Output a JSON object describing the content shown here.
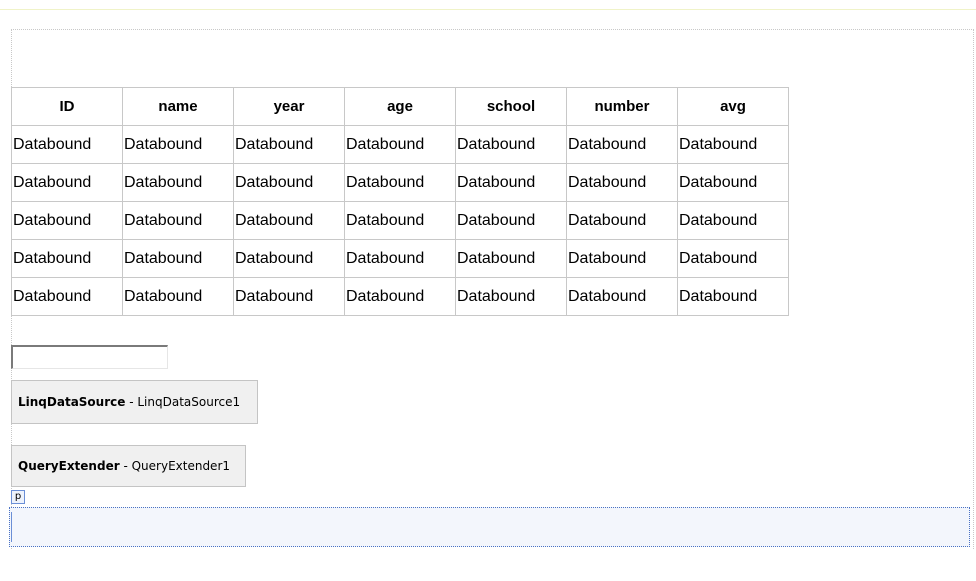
{
  "grid": {
    "headers": [
      "ID",
      "name",
      "year",
      "age",
      "school",
      "number",
      "avg"
    ],
    "rows": [
      [
        "Databound",
        "Databound",
        "Databound",
        "Databound",
        "Databound",
        "Databound",
        "Databound"
      ],
      [
        "Databound",
        "Databound",
        "Databound",
        "Databound",
        "Databound",
        "Databound",
        "Databound"
      ],
      [
        "Databound",
        "Databound",
        "Databound",
        "Databound",
        "Databound",
        "Databound",
        "Databound"
      ],
      [
        "Databound",
        "Databound",
        "Databound",
        "Databound",
        "Databound",
        "Databound",
        "Databound"
      ],
      [
        "Databound",
        "Databound",
        "Databound",
        "Databound",
        "Databound",
        "Databound",
        "Databound"
      ]
    ]
  },
  "textbox": {
    "value": ""
  },
  "controls": {
    "linq": {
      "type": "LinqDataSource",
      "separator": " - ",
      "id": "LinqDataSource1"
    },
    "query": {
      "type": "QueryExtender",
      "separator": " - ",
      "id": "QueryExtender1"
    }
  },
  "paragraph": {
    "tag": "p"
  }
}
